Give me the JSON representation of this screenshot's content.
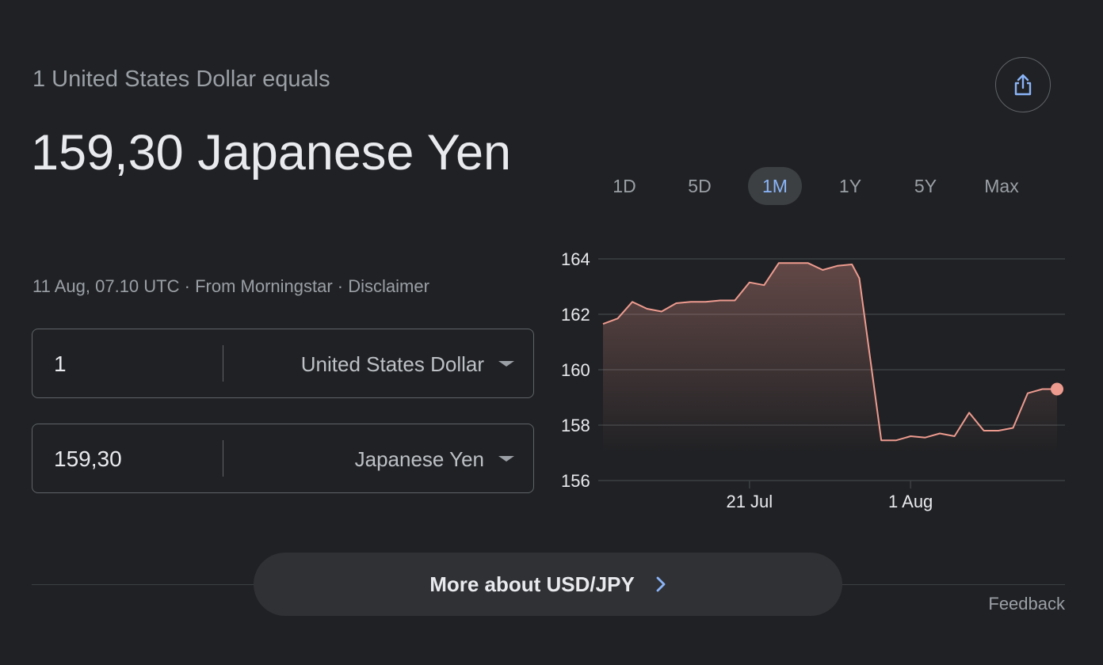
{
  "header": {
    "subtitle": "1 United States Dollar equals",
    "value": "159,30 Japanese Yen",
    "timestamp": "11 Aug, 07.10 UTC",
    "separator": " · ",
    "source": "From Morningstar",
    "disclaimer": "Disclaimer"
  },
  "converter": {
    "from": {
      "amount": "1",
      "currency": "United States Dollar"
    },
    "to": {
      "amount": "159,30",
      "currency": "Japanese Yen"
    }
  },
  "share": {
    "icon": "share-icon"
  },
  "ranges": [
    {
      "label": "1D",
      "active": false
    },
    {
      "label": "5D",
      "active": false
    },
    {
      "label": "1M",
      "active": true
    },
    {
      "label": "1Y",
      "active": false
    },
    {
      "label": "5Y",
      "active": false
    },
    {
      "label": "Max",
      "active": false
    }
  ],
  "chart_data": {
    "type": "area",
    "title": "",
    "xlabel": "",
    "ylabel": "",
    "ylim": [
      156,
      164
    ],
    "yticks": [
      164,
      162,
      160,
      158,
      156
    ],
    "xticks": [
      {
        "label": "21 Jul",
        "x": 10
      },
      {
        "label": "1 Aug",
        "x": 21
      }
    ],
    "xlim": [
      0,
      31
    ],
    "grid": true,
    "colors": {
      "line": "#ee9b8f",
      "fill": "#ee9b8f",
      "grid": "#3c4043",
      "tick": "#e8eaed"
    },
    "series": [
      {
        "x": [
          0,
          1,
          2,
          3,
          4,
          5,
          6,
          7,
          8,
          9,
          10,
          11,
          12,
          13,
          14,
          15,
          16,
          17,
          17.5,
          19,
          20,
          21,
          22,
          23,
          24,
          25,
          26,
          27,
          28,
          29,
          30,
          31
        ],
        "values": [
          161.65,
          161.85,
          162.45,
          162.2,
          162.1,
          162.4,
          162.45,
          162.45,
          162.5,
          162.5,
          163.15,
          163.05,
          163.85,
          163.85,
          163.85,
          163.6,
          163.75,
          163.8,
          163.3,
          157.45,
          157.45,
          157.6,
          157.55,
          157.7,
          157.6,
          158.45,
          157.8,
          157.8,
          157.9,
          159.15,
          159.3,
          159.3
        ]
      }
    ]
  },
  "more": {
    "label": "More about USD/JPY"
  },
  "feedback": {
    "label": "Feedback"
  }
}
